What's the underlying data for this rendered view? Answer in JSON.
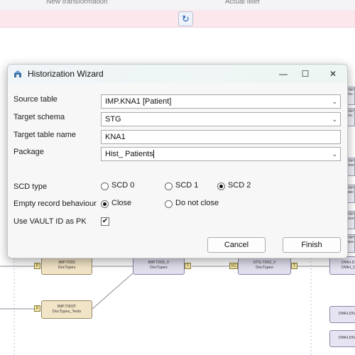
{
  "background": {
    "header_left": "New transformation",
    "header_right": "Actual filter",
    "nodes": {
      "imp_t003": "IMP.T003\nDocTypes",
      "imp_t003t": "IMP.T003T\nDocTypes_Texts",
      "imp_t003_v": "IMP.T003_V\nDocTypes",
      "stg_t003_v": "STG.T003_V\nDocTypes",
      "dwh_right": "DWH.DW\nDWH_Do",
      "dwh_b1": "DWH.DIV",
      "dwh_b2": "DWH.DIV"
    },
    "port_labels": {
      "p": "P",
      "t": "T",
      "vc": "VC"
    },
    "side_boxes": [
      "DWH.DI\nDoc",
      "DWH.DI\nDoc",
      "DWH.DI\nstom",
      "DWH.DI\nndor",
      "DWH.DI\ncoun",
      "DWH.DI\nmpa"
    ]
  },
  "dialog": {
    "title": "Historization Wizard",
    "window_buttons": {
      "minimize": "—",
      "maximize": "☐",
      "close": "✕"
    },
    "fields": {
      "source_table": {
        "label": "Source table",
        "value": "IMP.KNA1 [Patient]"
      },
      "target_schema": {
        "label": "Target schema",
        "value": "STG"
      },
      "target_table_name": {
        "label": "Target table name",
        "value": "KNA1"
      },
      "package": {
        "label": "Package",
        "value": "Hist_ Patients"
      }
    },
    "scd_type": {
      "label": "SCD type",
      "options": [
        "SCD 0",
        "SCD 1",
        "SCD 2"
      ],
      "selected": "SCD 2"
    },
    "empty_record": {
      "label": "Empty record behaviour",
      "options": [
        "Close",
        "Do not close"
      ],
      "selected": "Close"
    },
    "vault_id": {
      "label": "Use VAULT ID as PK",
      "checked": true,
      "check_glyph": "✔"
    },
    "buttons": {
      "cancel": "Cancel",
      "finish": "Finish"
    }
  },
  "colors": {
    "pink_bar": "#fbe7ec",
    "source_node": "#f2e4c6",
    "mid_node": "#e2dfee",
    "refresh_icon": "#1f5fb4"
  }
}
